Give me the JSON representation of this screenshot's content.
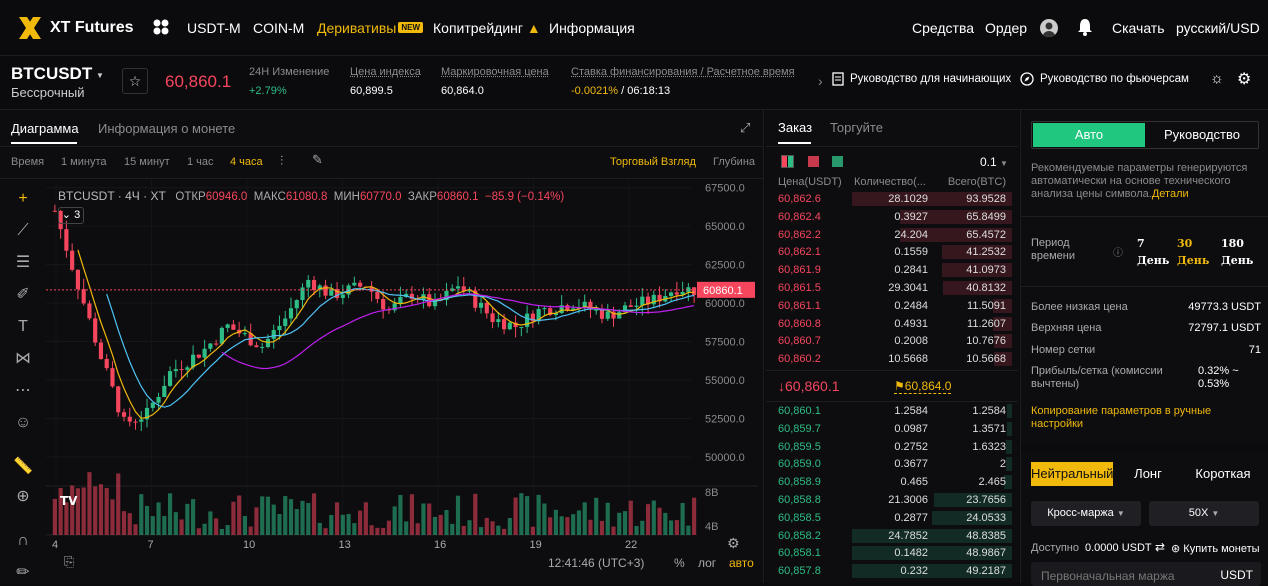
{
  "nav": {
    "brand": "XT Futures",
    "usdt_m": "USDT-M",
    "coin_m": "COIN-M",
    "derivatives": "Деривативы",
    "new_badge": "NEW",
    "copytrading": "Копитрейдинг",
    "info": "Информация",
    "assets": "Средства",
    "orders": "Ордер",
    "download": "Скачать",
    "lang": "русский/USD"
  },
  "ticker": {
    "symbol": "BTCUSDT",
    "type": "Бессрочный",
    "price": "60,860.1",
    "change_label": "24H Изменение",
    "change_value": "+2.79%",
    "index_label": "Цена индекса",
    "index_value": "60,899.5",
    "mark_label": "Маркировочная цена",
    "mark_value": "60,864.0",
    "funding_label": "Ставка финансирования / Расчетное время",
    "funding_rate": "-0.0021%",
    "funding_time": "06:18:13",
    "guide_beginners": "Руководство для начинающих",
    "guide_futures": "Руководство по фьючерсам"
  },
  "chart": {
    "tab_chart": "Диаграмма",
    "tab_info": "Информация о монете",
    "time_label": "Время",
    "tf1": "1 минута",
    "tf2": "15 минут",
    "tf3": "1 час",
    "tf4": "4 часа",
    "trading_view": "Торговый Взгляд",
    "depth": "Глубина",
    "legend_title": "BTCUSDT · 4Ч · XT",
    "open_l": "ОТКР",
    "open_v": "60946.0",
    "high_l": "МАКС",
    "high_v": "61080.8",
    "low_l": "МИН",
    "low_v": "60770.0",
    "close_l": "ЗАКР",
    "close_v": "60860.1",
    "change": "−85.9 (−0.14%)",
    "indicator_count": "3",
    "price_tag": "60860.1",
    "y_ticks": [
      "67500.0",
      "65000.0",
      "62500.0",
      "60000.0",
      "57500.0",
      "55000.0",
      "52500.0",
      "50000.0"
    ],
    "vol_ticks": [
      "8B",
      "4B"
    ],
    "x_ticks": [
      "4",
      "7",
      "10",
      "13",
      "16",
      "19",
      "22"
    ],
    "clock": "12:41:46 (UTC+3)",
    "pct": "%",
    "log": "лог",
    "auto": "авто"
  },
  "chart_data": {
    "type": "candlestick",
    "symbol": "BTCUSDT",
    "interval": "4h",
    "ylim": [
      48500,
      68000
    ],
    "last": 60860.1
  },
  "orderbook": {
    "tab_order": "Заказ",
    "tab_trades": "Торгуйте",
    "precision": "0.1",
    "col_price": "Цена(USDT)",
    "col_qty": "Количество(...",
    "col_total": "Всего(BTC)",
    "asks": [
      [
        "60,862.6",
        "28.1029",
        "93.9528",
        1.0
      ],
      [
        "60,862.4",
        "0.3927",
        "65.8499",
        0.7
      ],
      [
        "60,862.2",
        "24.204",
        "65.4572",
        0.7
      ],
      [
        "60,862.1",
        "0.1559",
        "41.2532",
        0.44
      ],
      [
        "60,861.9",
        "0.2841",
        "41.0973",
        0.44
      ],
      [
        "60,861.5",
        "29.3041",
        "40.8132",
        0.43
      ],
      [
        "60,861.1",
        "0.2484",
        "11.5091",
        0.12
      ],
      [
        "60,860.8",
        "0.4931",
        "11.2607",
        0.12
      ],
      [
        "60,860.7",
        "0.2008",
        "10.7676",
        0.11
      ],
      [
        "60,860.2",
        "10.5668",
        "10.5668",
        0.11
      ]
    ],
    "last_price": "↓60,860.1",
    "mark_price": "60,864.0",
    "bids": [
      [
        "60,860.1",
        "1.2584",
        "1.2584",
        0.03
      ],
      [
        "60,859.7",
        "0.0987",
        "1.3571",
        0.03
      ],
      [
        "60,859.5",
        "0.2752",
        "1.6323",
        0.04
      ],
      [
        "60,859.0",
        "0.3677",
        "2",
        0.04
      ],
      [
        "60,858.9",
        "0.465",
        "2.465",
        0.05
      ],
      [
        "60,858.8",
        "21.3006",
        "23.7656",
        0.49
      ],
      [
        "60,858.5",
        "0.2877",
        "24.0533",
        0.5
      ],
      [
        "60,858.2",
        "24.7852",
        "48.8385",
        1.0
      ],
      [
        "60,858.1",
        "0.1482",
        "48.9867",
        1.0
      ],
      [
        "60,857.8",
        "0.232",
        "49.2187",
        1.0
      ]
    ]
  },
  "bot": {
    "auto": "Авто",
    "manual": "Руководство",
    "desc": "Рекомендуемые параметры генерируются автоматически на основе технического анализа цены символа.",
    "details": "Детали",
    "period_label": "Период времени",
    "periods": [
      [
        "7",
        "День"
      ],
      [
        "30",
        "День"
      ],
      [
        "180",
        "День"
      ]
    ],
    "lower_label": "Более низкая цена",
    "lower_value": "49773.3 USDT",
    "upper_label": "Верхняя цена",
    "upper_value": "72797.1 USDT",
    "grid_label": "Номер сетки",
    "grid_value": "71",
    "profit_label": "Прибыль/сетка (комиссии вычтены)",
    "profit_value": "0.32% ~ 0.53%",
    "copy_params": "Копирование параметров в ручные настройки",
    "neutral": "Нейтральный",
    "long": "Лонг",
    "short": "Короткая",
    "margin": "Кросс-маржа",
    "leverage": "50X",
    "available_label": "Доступно",
    "available_value": "0.0000 USDT",
    "buy_coins": "Купить монеты",
    "initial_margin": "Первоначальная маржа",
    "currency": "USDT"
  },
  "colors": {
    "up": "#2ebd85",
    "down": "#f6465d",
    "accent": "#f0b90b",
    "active_green": "#20c77f"
  }
}
